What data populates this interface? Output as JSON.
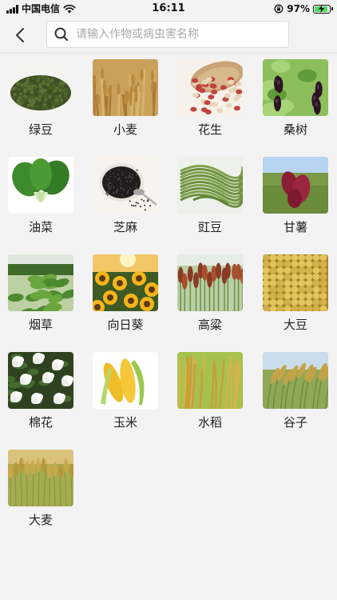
{
  "status_bar": {
    "carrier": "中国电信",
    "time": "16:11",
    "battery_percent": "97%",
    "battery_level": 0.97,
    "signal_icon": "signal-bars-icon",
    "wifi_icon": "wifi-icon",
    "orientation_lock_icon": "rotation-lock-icon",
    "battery_icon": "battery-charging-icon"
  },
  "nav": {
    "back_icon": "chevron-left-icon",
    "search_placeholder": "请输入作物或病虫害名称",
    "search_value": "",
    "search_icon": "search-icon"
  },
  "crops": [
    {
      "name": "绿豆",
      "photo": "mung-bean-photo"
    },
    {
      "name": "小麦",
      "photo": "wheat-photo"
    },
    {
      "name": "花生",
      "photo": "peanut-photo"
    },
    {
      "name": "桑树",
      "photo": "mulberry-photo"
    },
    {
      "name": "油菜",
      "photo": "bok-choy-photo"
    },
    {
      "name": "芝麻",
      "photo": "sesame-photo"
    },
    {
      "name": "豇豆",
      "photo": "cowpea-photo"
    },
    {
      "name": "甘薯",
      "photo": "sweet-potato-photo"
    },
    {
      "name": "烟草",
      "photo": "tobacco-photo"
    },
    {
      "name": "向日葵",
      "photo": "sunflower-photo"
    },
    {
      "name": "高粱",
      "photo": "sorghum-photo"
    },
    {
      "name": "大豆",
      "photo": "soybean-photo"
    },
    {
      "name": "棉花",
      "photo": "cotton-photo"
    },
    {
      "name": "玉米",
      "photo": "corn-photo"
    },
    {
      "name": "水稻",
      "photo": "rice-photo"
    },
    {
      "name": "谷子",
      "photo": "millet-photo"
    },
    {
      "name": "大麦",
      "photo": "barley-photo"
    }
  ]
}
